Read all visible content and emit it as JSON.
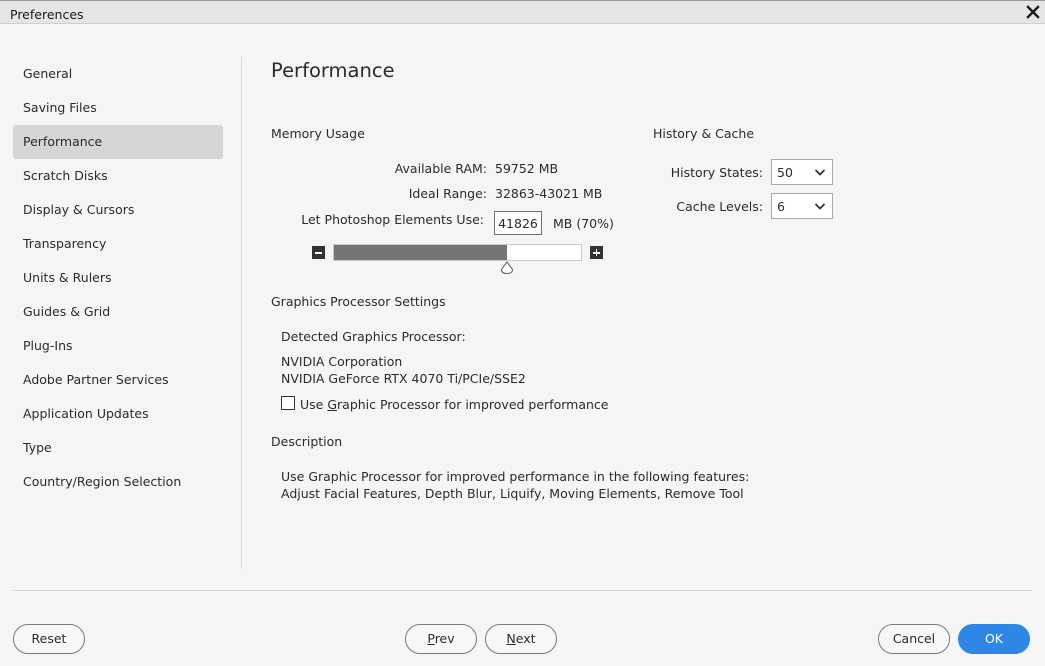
{
  "window": {
    "title": "Preferences"
  },
  "sidebar": {
    "items": [
      {
        "label": "General"
      },
      {
        "label": "Saving Files"
      },
      {
        "label": "Performance"
      },
      {
        "label": "Scratch Disks"
      },
      {
        "label": "Display & Cursors"
      },
      {
        "label": "Transparency"
      },
      {
        "label": "Units & Rulers"
      },
      {
        "label": "Guides & Grid"
      },
      {
        "label": "Plug-Ins"
      },
      {
        "label": "Adobe Partner Services"
      },
      {
        "label": "Application Updates"
      },
      {
        "label": "Type"
      },
      {
        "label": "Country/Region Selection"
      }
    ],
    "selected": "Performance"
  },
  "main": {
    "title": "Performance",
    "memory": {
      "section_label": "Memory Usage",
      "available_ram_label": "Available RAM:",
      "available_ram_value": "59752 MB",
      "ideal_range_label": "Ideal Range:",
      "ideal_range_value": "32863-43021 MB",
      "use_label": "Let Photoshop Elements Use:",
      "use_value": "41826",
      "use_suffix": "MB (70%)",
      "slider_fraction": 0.7
    },
    "history": {
      "section_label": "History & Cache",
      "history_states_label": "History States:",
      "history_states_value": "50",
      "cache_levels_label": "Cache Levels:",
      "cache_levels_value": "6"
    },
    "gpu": {
      "section_label": "Graphics Processor Settings",
      "detected_label": "Detected Graphics Processor:",
      "vendor": "NVIDIA Corporation",
      "model": "NVIDIA GeForce RTX 4070 Ti/PCIe/SSE2",
      "checkbox_prefix": "Use ",
      "checkbox_mnemonic": "G",
      "checkbox_rest": "raphic Processor for improved performance",
      "checked": false
    },
    "description": {
      "section_label": "Description",
      "line1": "Use Graphic Processor for improved performance in the following features:",
      "line2": "Adjust Facial Features, Depth Blur, Liquify, Moving Elements, Remove Tool"
    }
  },
  "footer": {
    "reset": "Reset",
    "prev_mnemonic": "P",
    "prev_rest": "rev",
    "next_mnemonic": "N",
    "next_rest": "ext",
    "cancel": "Cancel",
    "ok": "OK"
  },
  "colors": {
    "accent": "#2e86e6",
    "slider_fill": "#757575",
    "selected_bg": "#d6d6d6"
  }
}
